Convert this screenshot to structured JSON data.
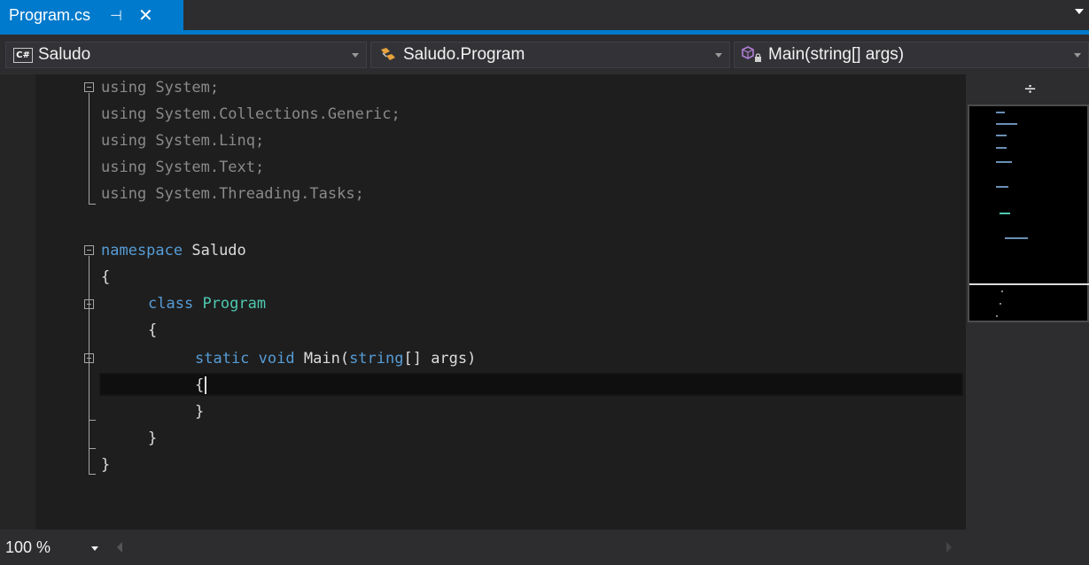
{
  "tab": {
    "title": "Program.cs",
    "pin_glyph": "⊣",
    "close_glyph": "✕"
  },
  "navbar": {
    "project": "Saludo",
    "project_icon_text": "C#",
    "type": "Saludo.Program",
    "member": "Main(string[] args)"
  },
  "code": {
    "line1_kw": "using",
    "line1_rest": " System;",
    "line2_kw": "using",
    "line2_rest": " System.Collections.Generic;",
    "line3_kw": "using",
    "line3_rest": " System.Linq;",
    "line4_kw": "using",
    "line4_rest": " System.Text;",
    "line5_kw": "using",
    "line5_rest": " System.Threading.Tasks;",
    "line7_kw": "namespace",
    "line7_rest": " Saludo",
    "line8": "{",
    "line9_kw": "class",
    "line9_type": "Program",
    "line10": "{",
    "line11_kw1": "static",
    "line11_kw2": "void",
    "line11_name": "Main(",
    "line11_kw3": "string",
    "line11_rest": "[] args)",
    "line12": "{",
    "line13": "}",
    "line14": "}",
    "line15": "}"
  },
  "minimap": {
    "split_glyph": "÷"
  },
  "status": {
    "zoom": "100 %"
  },
  "colors": {
    "accent": "#007acc",
    "keyword": "#569cd6",
    "type": "#4ec9b0",
    "editor_bg": "#1e1e1e"
  }
}
